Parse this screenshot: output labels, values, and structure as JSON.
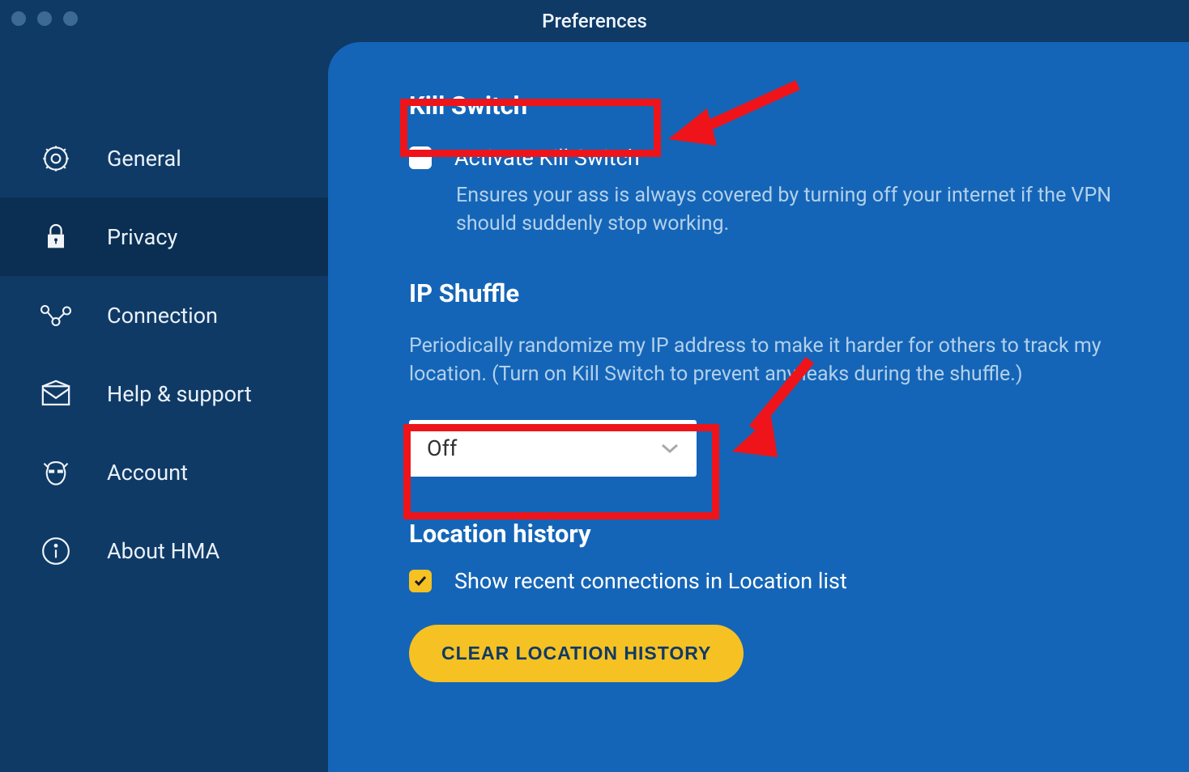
{
  "titlebar": {
    "title": "Preferences"
  },
  "sidebar": {
    "items": [
      {
        "id": "general",
        "label": "General",
        "icon": "gear"
      },
      {
        "id": "privacy",
        "label": "Privacy",
        "icon": "lock",
        "active": true
      },
      {
        "id": "connection",
        "label": "Connection",
        "icon": "nodes"
      },
      {
        "id": "help",
        "label": "Help & support",
        "icon": "envelope"
      },
      {
        "id": "account",
        "label": "Account",
        "icon": "donkey"
      },
      {
        "id": "about",
        "label": "About HMA",
        "icon": "info"
      }
    ]
  },
  "killswitch": {
    "heading": "Kill Switch",
    "label": "Activate Kill Switch",
    "checked": false,
    "description": "Ensures your ass is always covered by turning off your internet if the VPN should suddenly stop working."
  },
  "ipshuffle": {
    "heading": "IP Shuffle",
    "description": "Periodically randomize my IP address to make it harder for others to track my location. (Turn on Kill Switch to prevent any leaks during the shuffle.)",
    "dropdown_value": "Off"
  },
  "location_history": {
    "heading": "Location history",
    "show_recent_label": "Show recent connections in Location list",
    "show_recent_checked": true,
    "clear_button": "CLEAR LOCATION HISTORY"
  }
}
